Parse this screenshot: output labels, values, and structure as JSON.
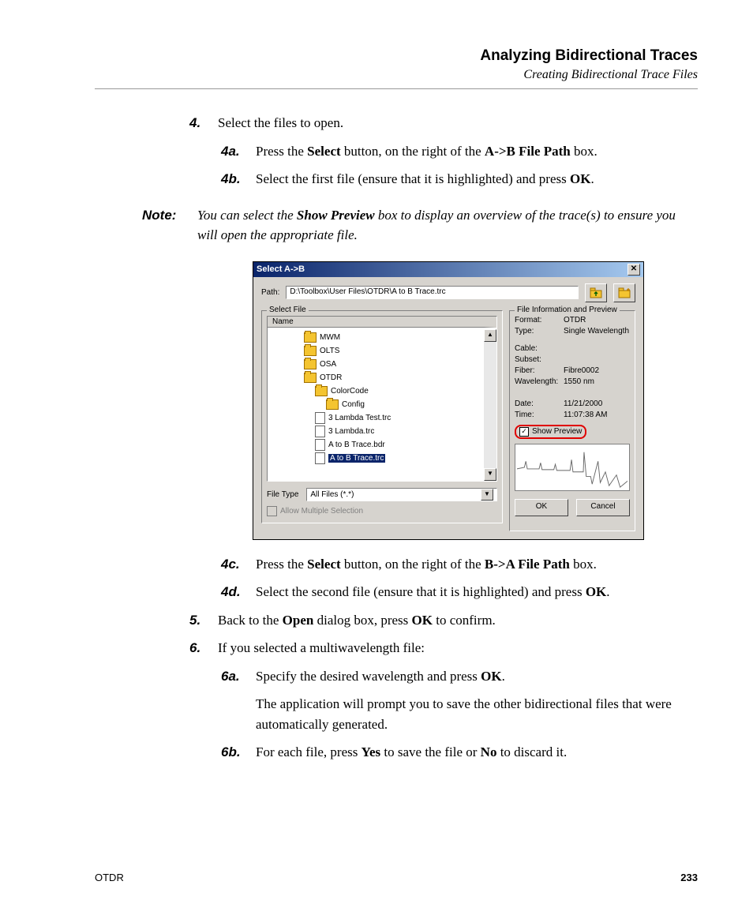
{
  "header": {
    "title": "Analyzing Bidirectional Traces",
    "subtitle": "Creating Bidirectional Trace Files"
  },
  "steps": {
    "s4": {
      "num": "4.",
      "text": "Select the files to open."
    },
    "s4a": {
      "num": "4a.",
      "pre": "Press the ",
      "b1": "Select",
      "mid": " button, on the right of the ",
      "b2": "A->B File Path",
      "post": " box."
    },
    "s4b": {
      "num": "4b.",
      "pre": "Select the first file (ensure that it is highlighted) and press ",
      "b1": "OK",
      "post": "."
    },
    "s4c": {
      "num": "4c.",
      "pre": "Press the ",
      "b1": "Select",
      "mid": " button, on the right of the ",
      "b2": "B->A File Path",
      "post": " box."
    },
    "s4d": {
      "num": "4d.",
      "pre": "Select the second file (ensure that it is highlighted) and press ",
      "b1": "OK",
      "post": "."
    },
    "s5": {
      "num": "5.",
      "pre": "Back to the ",
      "b1": "Open",
      "mid": " dialog box, press ",
      "b2": "OK",
      "post": " to confirm."
    },
    "s6": {
      "num": "6.",
      "text": "If you selected a multiwavelength file:"
    },
    "s6a": {
      "num": "6a.",
      "pre": "Specify the desired wavelength and press ",
      "b1": "OK",
      "post": ".",
      "para2": "The application will prompt you to save the other bidirectional files that were automatically generated."
    },
    "s6b": {
      "num": "6b.",
      "pre": "For each file, press ",
      "b1": "Yes",
      "mid": " to save the file or ",
      "b2": "No",
      "post": " to discard it."
    }
  },
  "note": {
    "label": "Note:",
    "pre": "You can select the ",
    "b1": "Show Preview",
    "post": " box to display an overview of the trace(s) to ensure you will open the appropriate file."
  },
  "dialog": {
    "title": "Select A->B",
    "path_label": "Path:",
    "path_value": "D:\\Toolbox\\User Files\\OTDR\\A to B Trace.trc",
    "select_file_legend": "Select File",
    "name_header": "Name",
    "tree": {
      "f1": "MWM",
      "f2": "OLTS",
      "f3": "OSA",
      "f4": "OTDR",
      "f5": "ColorCode",
      "f6": "Config",
      "file1": "3 Lambda Test.trc",
      "file2": "3 Lambda.trc",
      "file3": "A to B Trace.bdr",
      "file4": "A to B Trace.trc"
    },
    "filetype_label": "File Type",
    "filetype_value": "All Files (*.*)",
    "allow_multi": "Allow Multiple Selection",
    "info_legend": "File Information and Preview",
    "info": {
      "format_l": "Format:",
      "format_v": "OTDR",
      "type_l": "Type:",
      "type_v": "Single Wavelength",
      "cable_l": "Cable:",
      "cable_v": "",
      "subset_l": "Subset:",
      "subset_v": "",
      "fiber_l": "Fiber:",
      "fiber_v": "Fibre0002",
      "wave_l": "Wavelength:",
      "wave_v": "1550 nm",
      "date_l": "Date:",
      "date_v": "11/21/2000",
      "time_l": "Time:",
      "time_v": "11:07:38 AM"
    },
    "show_preview": "Show Preview",
    "ok": "OK",
    "cancel": "Cancel"
  },
  "footer": {
    "left": "OTDR",
    "right": "233"
  }
}
